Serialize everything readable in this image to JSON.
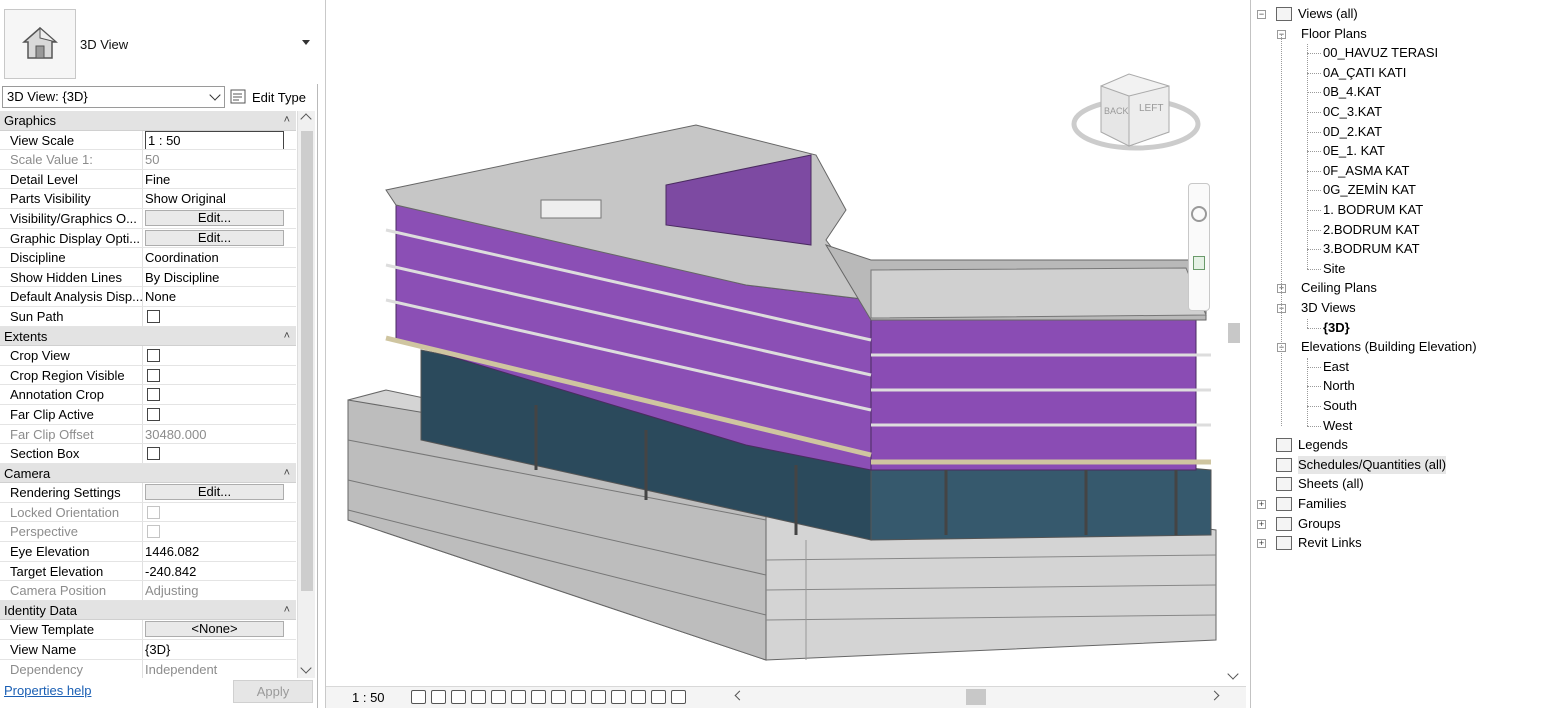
{
  "properties": {
    "type_name": "3D View",
    "view_selector": "3D View: {3D}",
    "edit_type": "Edit Type",
    "sections": [
      {
        "title": "Graphics",
        "rows": [
          {
            "label": "View Scale",
            "value": "1 : 50",
            "kind": "input"
          },
          {
            "label": "Scale Value    1:",
            "value": "50",
            "kind": "text",
            "disabled": true
          },
          {
            "label": "Detail Level",
            "value": "Fine",
            "kind": "text"
          },
          {
            "label": "Parts Visibility",
            "value": "Show Original",
            "kind": "text"
          },
          {
            "label": "Visibility/Graphics O...",
            "value": "Edit...",
            "kind": "button"
          },
          {
            "label": "Graphic Display Opti...",
            "value": "Edit...",
            "kind": "button"
          },
          {
            "label": "Discipline",
            "value": "Coordination",
            "kind": "text"
          },
          {
            "label": "Show Hidden Lines",
            "value": "By Discipline",
            "kind": "text"
          },
          {
            "label": "Default Analysis Disp...",
            "value": "None",
            "kind": "text"
          },
          {
            "label": "Sun Path",
            "value": "",
            "kind": "checkbox"
          }
        ]
      },
      {
        "title": "Extents",
        "rows": [
          {
            "label": "Crop View",
            "value": "",
            "kind": "checkbox"
          },
          {
            "label": "Crop Region Visible",
            "value": "",
            "kind": "checkbox"
          },
          {
            "label": "Annotation Crop",
            "value": "",
            "kind": "checkbox"
          },
          {
            "label": "Far Clip Active",
            "value": "",
            "kind": "checkbox"
          },
          {
            "label": "Far Clip Offset",
            "value": "30480.000",
            "kind": "text",
            "disabled": true
          },
          {
            "label": "Section Box",
            "value": "",
            "kind": "checkbox"
          }
        ]
      },
      {
        "title": "Camera",
        "rows": [
          {
            "label": "Rendering Settings",
            "value": "Edit...",
            "kind": "button"
          },
          {
            "label": "Locked Orientation",
            "value": "",
            "kind": "checkbox",
            "disabled": true
          },
          {
            "label": "Perspective",
            "value": "",
            "kind": "checkbox",
            "disabled": true
          },
          {
            "label": "Eye Elevation",
            "value": "1446.082",
            "kind": "text"
          },
          {
            "label": "Target Elevation",
            "value": "-240.842",
            "kind": "text"
          },
          {
            "label": "Camera Position",
            "value": "Adjusting",
            "kind": "text",
            "disabled": true
          }
        ]
      },
      {
        "title": "Identity Data",
        "rows": [
          {
            "label": "View Template",
            "value": "<None>",
            "kind": "button"
          },
          {
            "label": "View Name",
            "value": "{3D}",
            "kind": "text"
          },
          {
            "label": "Dependency",
            "value": "Independent",
            "kind": "text",
            "disabled": true
          }
        ]
      }
    ],
    "help_link": "Properties help",
    "apply_label": "Apply"
  },
  "viewcube": {
    "back": "BACK",
    "left": "LEFT"
  },
  "status": {
    "scale": "1 : 50"
  },
  "browser": {
    "root": "Views (all)",
    "floor_plans": {
      "label": "Floor Plans",
      "items": [
        "00_HAVUZ TERASI",
        "0A_ÇATI KATI",
        "0B_4.KAT",
        "0C_3.KAT",
        "0D_2.KAT",
        "0E_1. KAT",
        "0F_ASMA KAT",
        "0G_ZEMİN KAT",
        "1. BODRUM KAT",
        "2.BODRUM KAT",
        "3.BODRUM KAT",
        "Site"
      ]
    },
    "ceiling_plans": "Ceiling Plans",
    "views_3d": {
      "label": "3D Views",
      "items": [
        "{3D}"
      ]
    },
    "elevations": {
      "label": "Elevations (Building Elevation)",
      "items": [
        "East",
        "North",
        "South",
        "West"
      ]
    },
    "others": [
      "Legends",
      "Schedules/Quantities (all)",
      "Sheets (all)",
      "Families",
      "Groups",
      "Revit Links"
    ]
  },
  "colors": {
    "facade": "#8b4fb5",
    "slab": "#c9c9c9",
    "glass": "#1d3b4d"
  }
}
